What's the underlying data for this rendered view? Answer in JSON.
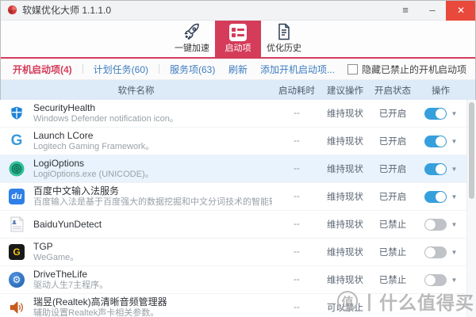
{
  "window": {
    "title": "软媒优化大师 1.1.1.0",
    "controls": {
      "menu": "≡",
      "minimize": "–",
      "close": "✕"
    }
  },
  "colors": {
    "accent": "#d43c5a",
    "close_button": "#e8493b",
    "link": "#3e7dc0",
    "toggle_on": "#36a0dd",
    "toggle_off": "#bfc3c7",
    "header_bg": "#ddeaf7",
    "highlight_row": "#e8f3fd"
  },
  "toolbar": {
    "items": [
      {
        "label": "一键加速",
        "icon": "rocket-icon"
      },
      {
        "label": "启动项",
        "icon": "startup-checklist-icon",
        "active": true
      },
      {
        "label": "优化历史",
        "icon": "history-document-icon"
      }
    ]
  },
  "tabbar": {
    "tabs": [
      {
        "label": "开机启动项(4)"
      },
      {
        "label": "计划任务(60)"
      },
      {
        "label": "服务项(63)"
      }
    ],
    "refresh": "刷新",
    "add": "添加开机启动项...",
    "hide_disabled_label": "隐藏已禁止的开机启动项",
    "hide_disabled_checked": false
  },
  "table": {
    "header": [
      "软件名称",
      "启动耗时",
      "建议操作",
      "开启状态",
      "操作"
    ],
    "rows": [
      {
        "icon": "windows-defender",
        "name": "SecurityHealth",
        "desc": "Windows Defender notification icon。",
        "time": "--",
        "suggest": "维持现状",
        "status": "已开启",
        "toggle": "on"
      },
      {
        "icon": "logitech-g",
        "name": "Launch LCore",
        "desc": "Logitech Gaming Framework。",
        "time": "--",
        "suggest": "维持现状",
        "status": "已开启",
        "toggle": "on"
      },
      {
        "icon": "logi-options-seal",
        "name": "LogiOptions",
        "desc": "LogiOptions.exe (UNICODE)。",
        "time": "--",
        "suggest": "维持现状",
        "status": "已开启",
        "toggle": "on"
      },
      {
        "icon": "baidu-du",
        "name": "百度中文输入法服务",
        "desc": "百度输入法是基于百度强大的数据挖掘和中文分词技术的智能输入法，为用户提供海量词...",
        "time": "--",
        "suggest": "维持现状",
        "status": "已开启",
        "toggle": "on"
      },
      {
        "icon": "generic-file",
        "name": "BaiduYunDetect",
        "desc": "",
        "time": "--",
        "suggest": "维持现状",
        "status": "已禁止",
        "toggle": "off"
      },
      {
        "icon": "tgp-wegame",
        "name": "TGP",
        "desc": "WeGame。",
        "time": "--",
        "suggest": "维持现状",
        "status": "已禁止",
        "toggle": "off"
      },
      {
        "icon": "drive-the-life-gear",
        "name": "DriveTheLife",
        "desc": "驱动人生7主程序。",
        "time": "--",
        "suggest": "维持现状",
        "status": "已禁止",
        "toggle": "off"
      },
      {
        "icon": "realtek-speaker",
        "name": "瑞昱(Realtek)高清晰音频管理器",
        "desc": "辅助设置Realtek声卡相关参数。",
        "time": "--",
        "suggest": "可以禁止",
        "status": "",
        "toggle": "none"
      }
    ]
  },
  "row_icon_glyphs": {
    "logitech_g": "G",
    "baidu_du": "du",
    "tgp_g": "G",
    "gear": "⚙"
  },
  "watermark": {
    "logo": "值",
    "text": "丨什么值得买"
  }
}
